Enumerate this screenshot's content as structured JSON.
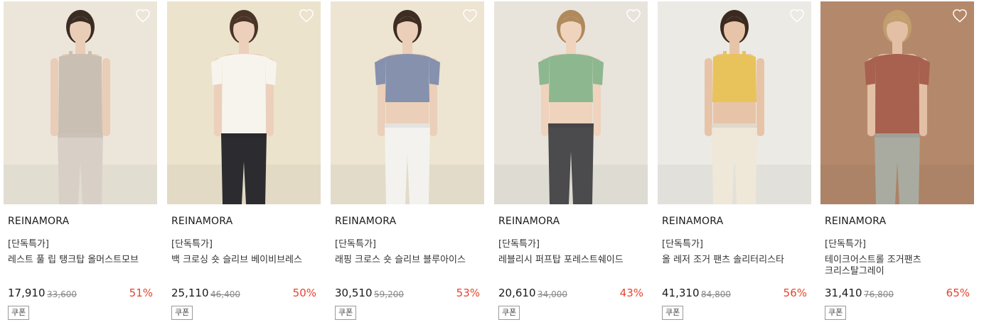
{
  "products": [
    {
      "brand": "REINAMORA",
      "tag": "[단독특가]",
      "name": "레스트 풀 립 탱크탑 올머스트모브",
      "price": "17,910",
      "original_price": "33,600",
      "discount": "51%",
      "coupon": "쿠폰",
      "image": {
        "bg": "#ece6da",
        "skin": "#e9cdb7",
        "hair": "#3a2c22",
        "top": "#c9bfb3",
        "bottom": "#d8d0c6",
        "sleeve": false,
        "crop": false,
        "alt": "탱크탑 모델 이미지"
      }
    },
    {
      "brand": "REINAMORA",
      "tag": "[단독특가]",
      "name": "백 크로싱 숏 슬리브 베이비브레스",
      "price": "25,110",
      "original_price": "46,400",
      "discount": "50%",
      "coupon": "쿠폰",
      "image": {
        "bg": "#ece3cc",
        "skin": "#ecd0bb",
        "hair": "#4a3428",
        "top": "#f7f4ee",
        "bottom": "#2c2c30",
        "sleeve": true,
        "crop": false,
        "alt": "숏 슬리브 모델 이미지"
      }
    },
    {
      "brand": "REINAMORA",
      "tag": "[단독특가]",
      "name": "래핑 크로스 숏 슬리브 블루아이스",
      "price": "30,510",
      "original_price": "59,200",
      "discount": "53%",
      "coupon": "쿠폰",
      "image": {
        "bg": "#ede4d2",
        "skin": "#ebcfb8",
        "hair": "#3d2d23",
        "top": "#8591ad",
        "bottom": "#f3f2ee",
        "sleeve": true,
        "crop": true,
        "alt": "크로스 숏 슬리브 모델 이미지"
      }
    },
    {
      "brand": "REINAMORA",
      "tag": "[단독특가]",
      "name": "레블리시 퍼프탑 포레스트쉐이드",
      "price": "20,610",
      "original_price": "34,000",
      "discount": "43%",
      "coupon": "쿠폰",
      "image": {
        "bg": "#e8e4dc",
        "skin": "#efd3bd",
        "hair": "#b08a5c",
        "top": "#8db88f",
        "bottom": "#4b4b4d",
        "sleeve": true,
        "crop": true,
        "alt": "퍼프탑 모델 이미지"
      }
    },
    {
      "brand": "REINAMORA",
      "tag": "[단독특가]",
      "name": "올 레저 조거 팬츠 솔리터리스타",
      "price": "41,310",
      "original_price": "84,800",
      "discount": "56%",
      "coupon": "쿠폰",
      "image": {
        "bg": "#eceae4",
        "skin": "#e7c4a8",
        "hair": "#3b2a20",
        "top": "#e8c35b",
        "bottom": "#efe7d8",
        "sleeve": false,
        "crop": true,
        "alt": "조거 팬츠 모델 이미지"
      }
    },
    {
      "brand": "REINAMORA",
      "tag": "[단독특가]",
      "name": "테이크어스트롤 조거팬츠 크리스탈그레이",
      "price": "31,410",
      "original_price": "76,800",
      "discount": "65%",
      "coupon": "쿠폰",
      "image": {
        "bg": "#b4896b",
        "skin": "#e3c0a5",
        "hair": "#c29e6f",
        "top": "#a8604f",
        "bottom": "#a9aba0",
        "sleeve": true,
        "crop": false,
        "alt": "조거팬츠 모델 이미지"
      }
    }
  ],
  "icons": {
    "wishlist": "heart-outline-icon"
  },
  "colors": {
    "discount": "#e8432b",
    "text": "#222222",
    "muted": "#888888"
  }
}
